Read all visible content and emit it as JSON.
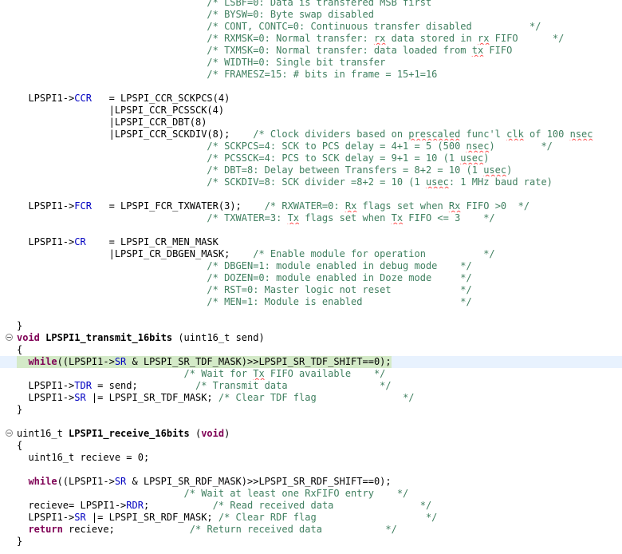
{
  "editor": {
    "lines": [
      {
        "code": [
          {
            "c": "cmt",
            "t": "                                 /* LSBF=0: Data is transfered MSB first"
          }
        ]
      },
      {
        "code": [
          {
            "c": "cmt",
            "t": "                                 /* BYSW=0: Byte swap disabled"
          }
        ]
      },
      {
        "code": [
          {
            "c": "cmt",
            "t": "                                 /* CONT, CONTC=0: Continuous transfer disabled          */"
          }
        ]
      },
      {
        "code": [
          {
            "c": "cmt",
            "t": "                                 /* RXMSK=0: Normal transfer: "
          },
          {
            "c": "cmt spell",
            "t": "rx"
          },
          {
            "c": "cmt",
            "t": " data stored in "
          },
          {
            "c": "cmt spell",
            "t": "rx"
          },
          {
            "c": "cmt",
            "t": " FIFO      */"
          }
        ]
      },
      {
        "code": [
          {
            "c": "cmt",
            "t": "                                 /* TXMSK=0: Normal transfer: data loaded from "
          },
          {
            "c": "cmt spell",
            "t": "tx"
          },
          {
            "c": "cmt",
            "t": " FIFO"
          }
        ]
      },
      {
        "code": [
          {
            "c": "cmt",
            "t": "                                 /* WIDTH=0: Single bit transfer"
          }
        ]
      },
      {
        "code": [
          {
            "c": "cmt",
            "t": "                                 /* FRAMESZ=15: # bits in frame = 15+1=16"
          }
        ]
      },
      {
        "code": []
      },
      {
        "code": [
          {
            "c": "plain",
            "t": "  LPSPI1->"
          },
          {
            "c": "fld",
            "t": "CCR"
          },
          {
            "c": "plain",
            "t": "   = LPSPI_CCR_SCKPCS(4)"
          }
        ]
      },
      {
        "code": [
          {
            "c": "plain",
            "t": "                |LPSPI_CCR_PCSSCK(4)"
          }
        ]
      },
      {
        "code": [
          {
            "c": "plain",
            "t": "                |LPSPI_CCR_DBT(8)"
          }
        ]
      },
      {
        "code": [
          {
            "c": "plain",
            "t": "                |LPSPI_CCR_SCKDIV(8);    "
          },
          {
            "c": "cmt",
            "t": "/* Clock dividers based on "
          },
          {
            "c": "cmt spell",
            "t": "prescaled"
          },
          {
            "c": "cmt",
            "t": " func'l "
          },
          {
            "c": "cmt spell",
            "t": "clk"
          },
          {
            "c": "cmt",
            "t": " of 100 "
          },
          {
            "c": "cmt spell",
            "t": "nsec"
          }
        ]
      },
      {
        "code": [
          {
            "c": "cmt",
            "t": "                                 /* SCKPCS=4: SCK to PCS delay = 4+1 = 5 (500 "
          },
          {
            "c": "cmt spell",
            "t": "nsec"
          },
          {
            "c": "cmt",
            "t": ")        */"
          }
        ]
      },
      {
        "code": [
          {
            "c": "cmt",
            "t": "                                 /* PCSSCK=4: PCS to SCK delay = 9+1 = 10 (1 "
          },
          {
            "c": "cmt spell",
            "t": "usec"
          },
          {
            "c": "cmt",
            "t": ")"
          }
        ]
      },
      {
        "code": [
          {
            "c": "cmt",
            "t": "                                 /* DBT=8: Delay between Transfers = 8+2 = 10 (1 "
          },
          {
            "c": "cmt spell",
            "t": "usec"
          },
          {
            "c": "cmt",
            "t": ")"
          }
        ]
      },
      {
        "code": [
          {
            "c": "cmt",
            "t": "                                 /* SCKDIV=8: SCK divider =8+2 = 10 (1 "
          },
          {
            "c": "cmt spell",
            "t": "usec"
          },
          {
            "c": "cmt",
            "t": ": 1 MHz baud rate)"
          }
        ]
      },
      {
        "code": []
      },
      {
        "code": [
          {
            "c": "plain",
            "t": "  LPSPI1->"
          },
          {
            "c": "fld",
            "t": "FCR"
          },
          {
            "c": "plain",
            "t": "   = LPSPI_FCR_TXWATER(3);    "
          },
          {
            "c": "cmt",
            "t": "/* RXWATER=0: "
          },
          {
            "c": "cmt spell",
            "t": "Rx"
          },
          {
            "c": "cmt",
            "t": " flags set when "
          },
          {
            "c": "cmt spell",
            "t": "Rx"
          },
          {
            "c": "cmt",
            "t": " FIFO >0  */"
          }
        ]
      },
      {
        "code": [
          {
            "c": "cmt",
            "t": "                                 /* TXWATER=3: "
          },
          {
            "c": "cmt spell",
            "t": "Tx"
          },
          {
            "c": "cmt",
            "t": " flags set when "
          },
          {
            "c": "cmt spell",
            "t": "Tx"
          },
          {
            "c": "cmt",
            "t": " FIFO <= 3    */"
          }
        ]
      },
      {
        "code": []
      },
      {
        "code": [
          {
            "c": "plain",
            "t": "  LPSPI1->"
          },
          {
            "c": "fld",
            "t": "CR"
          },
          {
            "c": "plain",
            "t": "    = LPSPI_CR_MEN_MASK"
          }
        ]
      },
      {
        "code": [
          {
            "c": "plain",
            "t": "                |LPSPI_CR_DBGEN_MASK;    "
          },
          {
            "c": "cmt",
            "t": "/* Enable module for operation          */"
          }
        ]
      },
      {
        "code": [
          {
            "c": "cmt",
            "t": "                                 /* DBGEN=1: module enabled in debug mode    */"
          }
        ]
      },
      {
        "code": [
          {
            "c": "cmt",
            "t": "                                 /* DOZEN=0: module enabled in Doze mode     */"
          }
        ]
      },
      {
        "code": [
          {
            "c": "cmt",
            "t": "                                 /* RST=0: Master logic not reset            */"
          }
        ]
      },
      {
        "code": [
          {
            "c": "cmt",
            "t": "                                 /* MEN=1: Module is enabled                 */"
          }
        ]
      },
      {
        "code": []
      },
      {
        "code": [
          {
            "c": "plain",
            "t": "}"
          }
        ]
      },
      {
        "fold": true,
        "code": [
          {
            "c": "kw",
            "t": "void"
          },
          {
            "c": "plain",
            "t": " "
          },
          {
            "c": "bold",
            "t": "LPSPI1_transmit_16bits"
          },
          {
            "c": "plain",
            "t": " (uint16_t send)"
          }
        ]
      },
      {
        "code": [
          {
            "c": "plain",
            "t": "{"
          }
        ]
      },
      {
        "current": true,
        "code": [
          {
            "c": "plain",
            "t": "  "
          },
          {
            "c": "kw",
            "t": "while"
          },
          {
            "c": "plain",
            "t": "((LPSPI1->"
          },
          {
            "c": "fld",
            "t": "SR"
          },
          {
            "c": "plain",
            "t": " & LPSPI_SR_TDF_MASK)>>LPSPI_SR_TDF_SHIFT==0);"
          }
        ]
      },
      {
        "code": [
          {
            "c": "cmt",
            "t": "                             /* Wait for "
          },
          {
            "c": "cmt spell",
            "t": "Tx"
          },
          {
            "c": "cmt",
            "t": " FIFO available    */"
          }
        ]
      },
      {
        "code": [
          {
            "c": "plain",
            "t": "  LPSPI1->"
          },
          {
            "c": "fld",
            "t": "TDR"
          },
          {
            "c": "plain",
            "t": " = send;          "
          },
          {
            "c": "cmt",
            "t": "/* Transmit data                */"
          }
        ]
      },
      {
        "code": [
          {
            "c": "plain",
            "t": "  LPSPI1->"
          },
          {
            "c": "fld",
            "t": "SR"
          },
          {
            "c": "plain",
            "t": " |= LPSPI_SR_TDF_MASK; "
          },
          {
            "c": "cmt",
            "t": "/* Clear TDF flag               */"
          }
        ]
      },
      {
        "code": [
          {
            "c": "plain",
            "t": "}"
          }
        ]
      },
      {
        "code": []
      },
      {
        "fold": true,
        "code": [
          {
            "c": "plain",
            "t": "uint16_t "
          },
          {
            "c": "bold",
            "t": "LPSPI1_receive_16bits"
          },
          {
            "c": "plain",
            "t": " ("
          },
          {
            "c": "kw",
            "t": "void"
          },
          {
            "c": "plain",
            "t": ")"
          }
        ]
      },
      {
        "code": [
          {
            "c": "plain",
            "t": "{"
          }
        ]
      },
      {
        "code": [
          {
            "c": "plain",
            "t": "  uint16_t recieve = 0;"
          }
        ]
      },
      {
        "code": []
      },
      {
        "code": [
          {
            "c": "plain",
            "t": "  "
          },
          {
            "c": "kw",
            "t": "while"
          },
          {
            "c": "plain",
            "t": "((LPSPI1->"
          },
          {
            "c": "fld",
            "t": "SR"
          },
          {
            "c": "plain",
            "t": " & LPSPI_SR_RDF_MASK)>>LPSPI_SR_RDF_SHIFT==0);"
          }
        ]
      },
      {
        "code": [
          {
            "c": "cmt",
            "t": "                             /* Wait at least one RxFIFO entry    */"
          }
        ]
      },
      {
        "code": [
          {
            "c": "plain",
            "t": "  recieve= LPSPI1->"
          },
          {
            "c": "fld",
            "t": "RDR"
          },
          {
            "c": "plain",
            "t": ";           "
          },
          {
            "c": "cmt",
            "t": "/* Read received data               */"
          }
        ]
      },
      {
        "code": [
          {
            "c": "plain",
            "t": "  LPSPI1->"
          },
          {
            "c": "fld",
            "t": "SR"
          },
          {
            "c": "plain",
            "t": " |= LPSPI_SR_RDF_MASK; "
          },
          {
            "c": "cmt",
            "t": "/* Clear RDF flag                   */"
          }
        ]
      },
      {
        "code": [
          {
            "c": "plain",
            "t": "  "
          },
          {
            "c": "kw",
            "t": "return"
          },
          {
            "c": "plain",
            "t": " recieve;             "
          },
          {
            "c": "cmt",
            "t": "/* Return received data           */"
          }
        ]
      },
      {
        "code": [
          {
            "c": "plain",
            "t": "}"
          }
        ]
      }
    ]
  }
}
